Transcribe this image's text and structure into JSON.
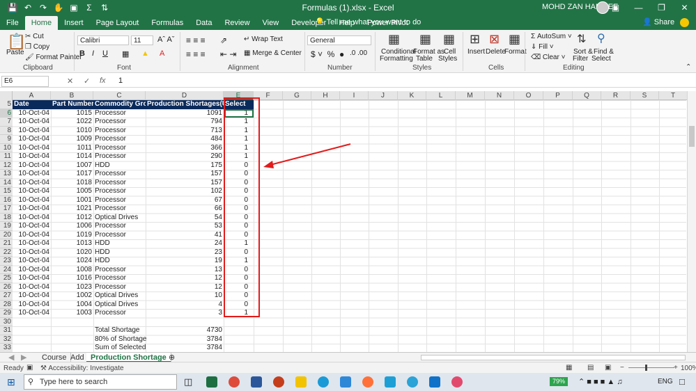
{
  "window": {
    "title": "Formulas (1).xlsx  -  Excel",
    "user": "MOHD ZAN HANIFEE"
  },
  "tabs": [
    "File",
    "Home",
    "Insert",
    "Page Layout",
    "Formulas",
    "Data",
    "Review",
    "View",
    "Developer",
    "Help",
    "Power Pivot"
  ],
  "tell_me": "Tell me what you want to do",
  "share": "Share",
  "ribbon": {
    "clipboard": {
      "label": "Clipboard",
      "paste": "Paste",
      "cut": "Cut",
      "copy": "Copy",
      "format_painter": "Format Painter"
    },
    "font": {
      "label": "Font",
      "name": "Calibri",
      "size": "11"
    },
    "alignment": {
      "label": "Alignment",
      "wrap": "Wrap Text",
      "merge": "Merge & Center"
    },
    "number": {
      "label": "Number",
      "format": "General"
    },
    "styles": {
      "label": "Styles",
      "cond": "Conditional",
      "cond2": "Formatting",
      "fmt_table": "Format as",
      "fmt_table2": "Table",
      "cell_styles": "Cell",
      "cell_styles2": "Styles"
    },
    "cells": {
      "label": "Cells",
      "insert": "Insert",
      "delete": "Delete",
      "format": "Format"
    },
    "editing": {
      "label": "Editing",
      "autosum": "AutoSum",
      "fill": "Fill",
      "clear": "Clear",
      "sort": "Sort &",
      "sort2": "Filter",
      "find": "Find &",
      "find2": "Select"
    }
  },
  "formula_bar": {
    "name_box": "E6",
    "value": "1"
  },
  "columns": [
    "A",
    "B",
    "C",
    "D",
    "E",
    "F",
    "G",
    "H",
    "I",
    "J",
    "K",
    "L",
    "M",
    "N",
    "O",
    "P",
    "Q",
    "R",
    "S",
    "T"
  ],
  "rows": [
    "5",
    "6",
    "7",
    "8",
    "9",
    "10",
    "11",
    "12",
    "13",
    "14",
    "15",
    "16",
    "17",
    "18",
    "19",
    "20",
    "21",
    "22",
    "23",
    "24",
    "25",
    "26",
    "27",
    "28",
    "29",
    "30",
    "31",
    "32",
    "33"
  ],
  "table_header": [
    "Date",
    "Part Number",
    "Commodity Group",
    "Production Shortages(Units)",
    "Select"
  ],
  "table_rows": [
    [
      "10-Oct-04",
      "1015",
      "Processor",
      "1091",
      "1"
    ],
    [
      "10-Oct-04",
      "1022",
      "Processor",
      "794",
      "1"
    ],
    [
      "10-Oct-04",
      "1010",
      "Processor",
      "713",
      "1"
    ],
    [
      "10-Oct-04",
      "1009",
      "Processor",
      "484",
      "1"
    ],
    [
      "10-Oct-04",
      "1011",
      "Processor",
      "366",
      "1"
    ],
    [
      "10-Oct-04",
      "1014",
      "Processor",
      "290",
      "1"
    ],
    [
      "10-Oct-04",
      "1007",
      "HDD",
      "175",
      "0"
    ],
    [
      "10-Oct-04",
      "1017",
      "Processor",
      "157",
      "0"
    ],
    [
      "10-Oct-04",
      "1018",
      "Processor",
      "157",
      "0"
    ],
    [
      "10-Oct-04",
      "1005",
      "Processor",
      "102",
      "0"
    ],
    [
      "10-Oct-04",
      "1001",
      "Processor",
      "67",
      "0"
    ],
    [
      "10-Oct-04",
      "1021",
      "Processor",
      "66",
      "0"
    ],
    [
      "10-Oct-04",
      "1012",
      "Optical Drives",
      "54",
      "0"
    ],
    [
      "10-Oct-04",
      "1006",
      "Processor",
      "53",
      "0"
    ],
    [
      "10-Oct-04",
      "1019",
      "Processor",
      "41",
      "0"
    ],
    [
      "10-Oct-04",
      "1013",
      "HDD",
      "24",
      "1"
    ],
    [
      "10-Oct-04",
      "1020",
      "HDD",
      "23",
      "0"
    ],
    [
      "10-Oct-04",
      "1024",
      "HDD",
      "19",
      "1"
    ],
    [
      "10-Oct-04",
      "1008",
      "Processor",
      "13",
      "0"
    ],
    [
      "10-Oct-04",
      "1016",
      "Processor",
      "12",
      "0"
    ],
    [
      "10-Oct-04",
      "1023",
      "Processor",
      "12",
      "0"
    ],
    [
      "10-Oct-04",
      "1002",
      "Optical Drives",
      "10",
      "0"
    ],
    [
      "10-Oct-04",
      "1004",
      "Optical Drives",
      "4",
      "0"
    ],
    [
      "10-Oct-04",
      "1003",
      "Processor",
      "3",
      "1"
    ]
  ],
  "summary": [
    [
      "Total Shortage",
      "4730"
    ],
    [
      "80% of Shortage",
      "3784"
    ],
    [
      "Sum of Selected",
      "3784"
    ]
  ],
  "sheets": [
    "Course",
    "Add",
    "Production Shortage"
  ],
  "status": {
    "ready": "Ready",
    "accessibility": "Accessibility: Investigate",
    "zoom": "100%"
  },
  "taskbar": {
    "search": "Type here to search",
    "battery": "79%",
    "lang": "ENG"
  },
  "colors": {
    "excel_green": "#217346",
    "header_fill": "#0b2a5c",
    "highlight_red": "#e31b1b"
  }
}
